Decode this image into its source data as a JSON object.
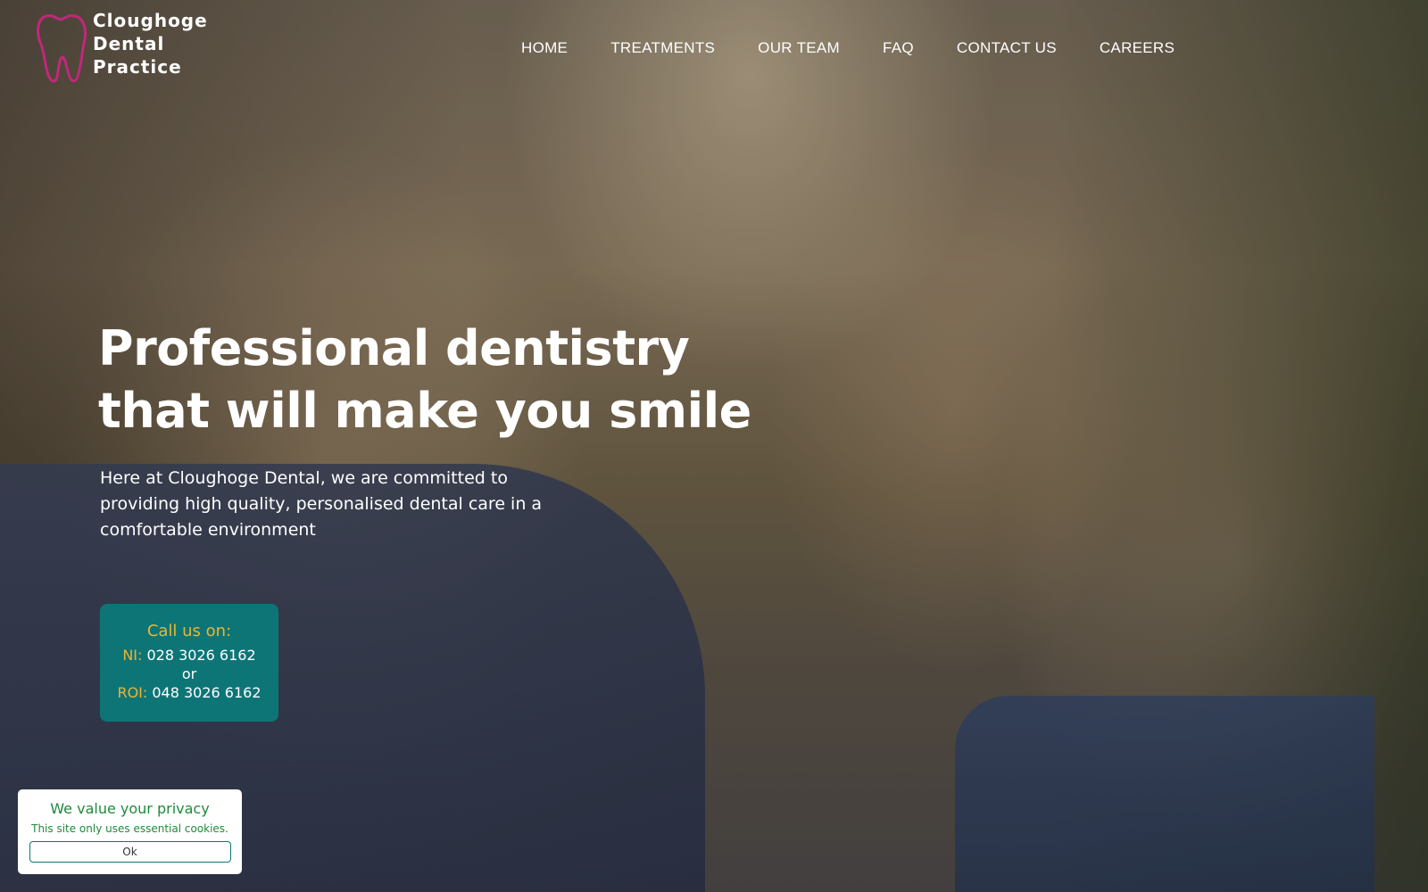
{
  "header": {
    "logo": {
      "icon": "tooth-icon",
      "line1": "Cloughoge",
      "line2": "Dental",
      "line3": "Practice",
      "icon_color": "#c0287a"
    },
    "nav": [
      {
        "label": "HOME"
      },
      {
        "label": "TREATMENTS"
      },
      {
        "label": "OUR TEAM"
      },
      {
        "label": "FAQ"
      },
      {
        "label": "CONTACT US"
      },
      {
        "label": "CAREERS"
      }
    ]
  },
  "hero": {
    "headline_line1": "Professional dentistry",
    "headline_line2": "that will make you smile",
    "subtext": "Here at Cloughoge Dental, we are committed to providing high quality, personalised dental care in a comfortable environment"
  },
  "call_box": {
    "title": "Call us on:",
    "ni_label": "NI:",
    "ni_number": "028 3026 6162",
    "or": "or",
    "roi_label": "ROI:",
    "roi_number": "048 3026 6162",
    "background": "#0e7577",
    "accent": "#e8b634"
  },
  "privacy": {
    "title": "We value your privacy",
    "text": "This site only uses essential cookies.",
    "ok_label": "Ok",
    "accent": "#1f8a3c"
  }
}
